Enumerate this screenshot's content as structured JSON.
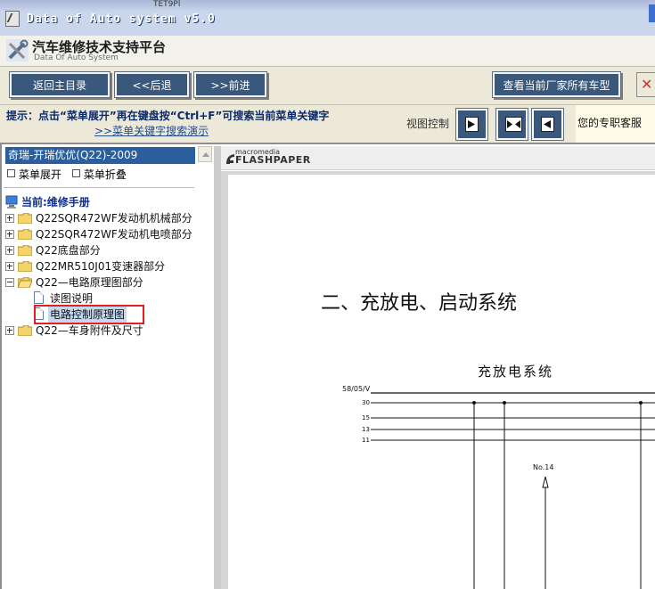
{
  "window": {
    "title": "Data of Auto system v5.0",
    "tab_peek": "TET9Pl"
  },
  "header": {
    "brand_cn": "汽车维修技术支持平台",
    "brand_en": "Data Of Auto System"
  },
  "nav": {
    "home": "返回主目录",
    "back": "<<后退",
    "forward": ">>前进",
    "all_models": "查看当前厂家所有车型"
  },
  "hint": {
    "line1": "提示：点击“菜单展开”再在键盘按“Ctrl+F”可搜索当前菜单关键字",
    "line2": ">>菜单关键字搜索演示",
    "view_control": "视图控制",
    "support": "您的专职客服"
  },
  "sidebar": {
    "vehicle": "奇瑞-开瑞优优(Q22)-2009",
    "expand": "菜单展开",
    "collapse": "菜单折叠",
    "current": "当前:维修手册",
    "tree": [
      {
        "label": "Q22SQR472WF发动机机械部分",
        "expanded": false
      },
      {
        "label": "Q22SQR472WF发动机电喷部分",
        "expanded": false
      },
      {
        "label": "Q22底盘部分",
        "expanded": false
      },
      {
        "label": "Q22MR510J01变速器部分",
        "expanded": false
      },
      {
        "label": "Q22—电路原理图部分",
        "expanded": true,
        "children": [
          {
            "label": "读图说明"
          },
          {
            "label": "电路控制原理图",
            "selected": true
          }
        ]
      },
      {
        "label": "Q22—车身附件及尺寸",
        "expanded": false
      }
    ]
  },
  "viewer": {
    "logo_top": "macromedia",
    "logo_bottom": "FLASHPAPER",
    "doc_title": "二、充放电、启动系统",
    "doc_subtitle": "充放电系统",
    "bus_labels": [
      "58/05/V",
      "30",
      "15",
      "13",
      "11"
    ],
    "node_label": "No.14"
  },
  "colors": {
    "button_bg": "#3a587c",
    "vehicle_bar": "#2a5e9c",
    "highlight": "#e02020"
  }
}
